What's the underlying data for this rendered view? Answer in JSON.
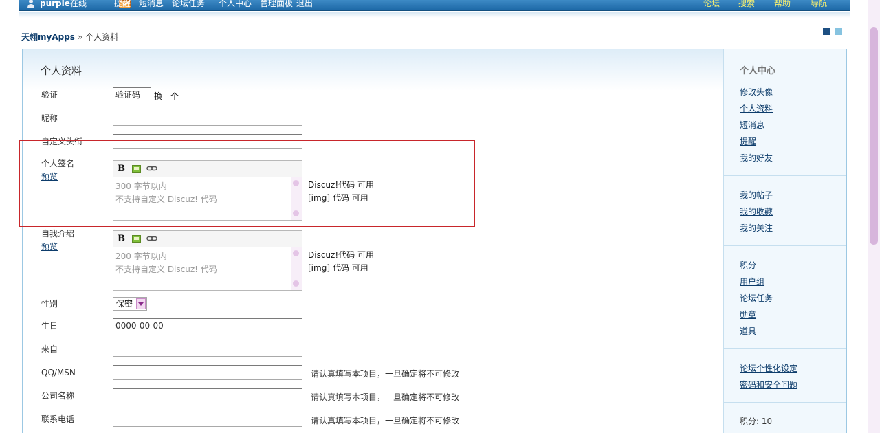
{
  "topbar": {
    "username": "purple",
    "online": "在线",
    "links": [
      "提醒",
      "短消息",
      "论坛任务",
      "个人中心",
      "管理面板",
      "退出"
    ],
    "right_links": [
      "论坛",
      "搜索",
      "帮助",
      "导航"
    ]
  },
  "breadcrumb": {
    "home": "天翎myApps",
    "separator": "»",
    "current": "个人资料"
  },
  "page_title": "个人资料",
  "form": {
    "captcha": {
      "label": "验证",
      "value": "验证码",
      "swap": "换一个"
    },
    "nickname": {
      "label": "昵称",
      "value": ""
    },
    "custom_title": {
      "label": "自定义头衔",
      "value": ""
    },
    "signature": {
      "label": "个人签名",
      "preview": "预览",
      "lines": [
        "300 字节以内",
        "不支持自定义  Discuz! 代码"
      ],
      "info": [
        "Discuz!代码  可用",
        "[img] 代码  可用"
      ]
    },
    "bio": {
      "label": "自我介绍",
      "preview": "预览",
      "lines": [
        "200 字节以内",
        "不支持自定义  Discuz! 代码"
      ],
      "info": [
        "Discuz!代码  可用",
        "[img] 代码  可用"
      ]
    },
    "gender": {
      "label": "性别",
      "value": "保密"
    },
    "birthday": {
      "label": "生日",
      "value": "0000-00-00"
    },
    "location": {
      "label": "来自",
      "value": ""
    },
    "qq": {
      "label": "QQ/MSN",
      "value": "",
      "hint": "请认真填写本项目，一旦确定将不可修改"
    },
    "company": {
      "label": "公司名称",
      "value": "",
      "hint": "请认真填写本项目，一旦确定将不可修改"
    },
    "phone": {
      "label": "联系电话",
      "value": "",
      "hint": "请认真填写本项目，一旦确定将不可修改"
    }
  },
  "sidebar": {
    "title": "个人中心",
    "group1": [
      "修改头像",
      "个人资料",
      "短消息",
      "提醒",
      "我的好友"
    ],
    "group2": [
      "我的帖子",
      "我的收藏",
      "我的关注"
    ],
    "group3": [
      "积分",
      "用户组",
      "论坛任务",
      "勋章",
      "道具"
    ],
    "group4": [
      "论坛个性化设定",
      "密码和安全问题"
    ],
    "score": "积分: 10"
  },
  "colors": {
    "accent": "#1f6aa8",
    "link": "#0d3c6b",
    "highlight_border": "#c8262b"
  }
}
